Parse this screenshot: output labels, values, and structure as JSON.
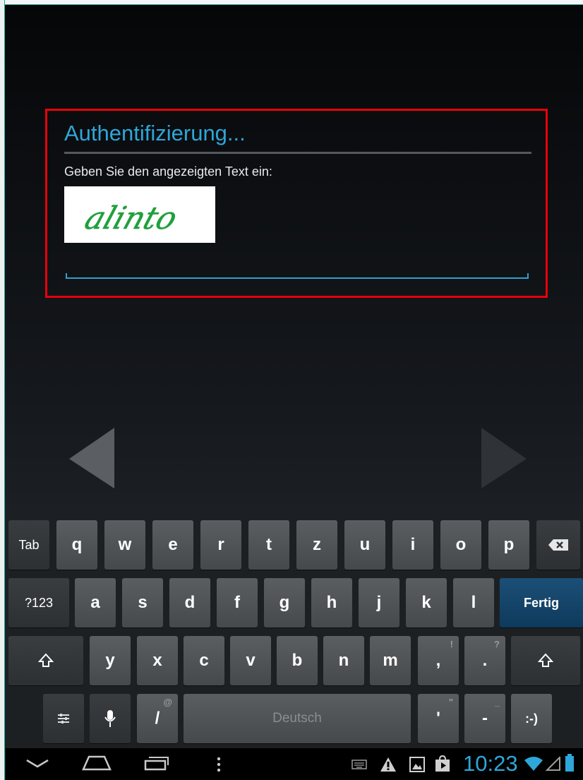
{
  "dialog": {
    "title": "Authentifizierung...",
    "prompt": "Geben Sie den angezeigten Text ein:",
    "captcha_text": "alinto",
    "input_value": ""
  },
  "keyboard": {
    "row1": [
      "q",
      "w",
      "e",
      "r",
      "t",
      "z",
      "u",
      "i",
      "o",
      "p"
    ],
    "row2": [
      "a",
      "s",
      "d",
      "f",
      "g",
      "h",
      "j",
      "k",
      "l"
    ],
    "row3": [
      "y",
      "x",
      "c",
      "v",
      "b",
      "n",
      "m",
      ",",
      "."
    ],
    "tab_label": "Tab",
    "numbers_label": "?123",
    "enter_label": "Fertig",
    "space_label": "Deutsch",
    "slash_label": "/",
    "slash_hint": "@",
    "comma_hint": "!",
    "period_hint": "?",
    "apostrophe_label": "'",
    "apostrophe_hint": "\"",
    "dash_label": "-",
    "dash_hint": "_",
    "smiley_label": ":-)"
  },
  "status_bar": {
    "time": "10:23"
  },
  "colors": {
    "accent": "#2ea6d8",
    "highlight_border": "#e8000b",
    "enter_key": "#0e3a5c"
  }
}
